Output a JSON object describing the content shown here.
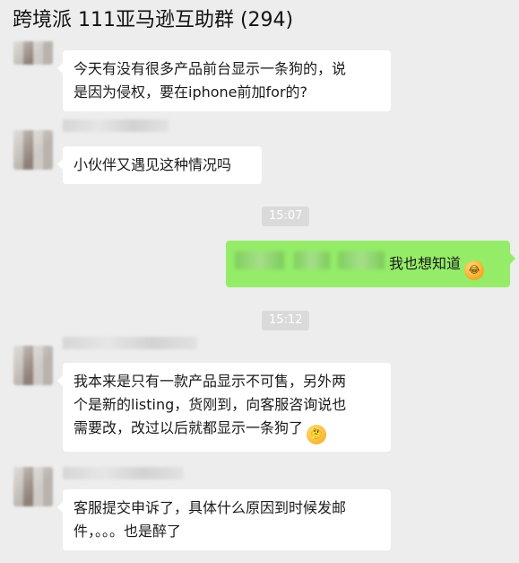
{
  "window": {
    "title": "跨境派 111亚马逊互助群 (294)"
  },
  "messages": [
    {
      "side": "left",
      "text_lines": [
        "今天有没有很多产品前台显示一条狗的，说",
        "是因为侵权，要在iphone前加for的?"
      ]
    },
    {
      "side": "left",
      "text_lines": [
        "小伙伴又遇见这种情况吗"
      ]
    },
    {
      "side": "time",
      "text": "15:07"
    },
    {
      "side": "right",
      "text": "我也想知道",
      "emoji": "face-with-tears-of-joy-icon"
    },
    {
      "side": "time",
      "text": "15:12"
    },
    {
      "side": "left",
      "text_lines": [
        "我本来是只有一款产品显示不可售，另外两",
        "个是新的listing，货刚到，向客服咨询说也",
        "需要改，改过以后就都显示一条狗了"
      ],
      "emoji": "thinking-face-icon"
    },
    {
      "side": "left",
      "text_lines": [
        "客服提交申诉了，具体什么原因到时候发邮",
        "件，。。。也是醉了"
      ]
    }
  ],
  "colors": {
    "background": "#ededed",
    "bubble_self": "#95ec69",
    "bubble_other": "#ffffff",
    "timestamp_bg": "#dadada"
  }
}
